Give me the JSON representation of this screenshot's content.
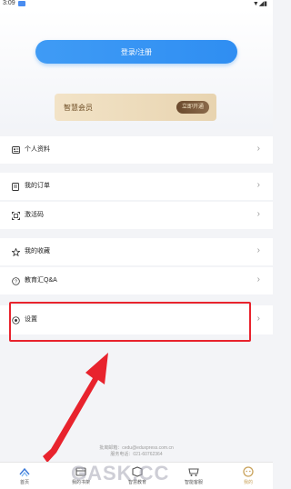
{
  "status_bar": {
    "time": "3:09",
    "signal": "▼◢▮"
  },
  "login": {
    "label": "登录/注册"
  },
  "vip": {
    "label": "智慧会员",
    "button": "立即开通"
  },
  "menu": [
    {
      "label": "个人资料",
      "icon": "profile-card-icon"
    },
    {
      "label": "我的订单",
      "icon": "order-doc-icon"
    },
    {
      "label": "激活码",
      "icon": "scan-code-icon"
    },
    {
      "label": "我的收藏",
      "icon": "star-icon"
    },
    {
      "label": "教育汇Q&A",
      "icon": "question-icon"
    },
    {
      "label": "设置",
      "icon": "gear-icon"
    }
  ],
  "footer": {
    "email": "批离邮箱：cedu@eduxpress.com.cn",
    "phone": "服务电话：021-60762364"
  },
  "tabs": [
    {
      "label": "首页",
      "icon": "home-icon"
    },
    {
      "label": "我的书架",
      "icon": "bookshelf-icon"
    },
    {
      "label": "智慧教育",
      "icon": "edu-icon"
    },
    {
      "label": "智能客服",
      "icon": "service-icon"
    },
    {
      "label": "我的",
      "icon": "me-icon"
    }
  ],
  "watermark": "GASK.CC",
  "colors": {
    "accent_blue": "#2f8ef2",
    "highlight_red": "#e8232d",
    "gold": "#c9a35c"
  }
}
